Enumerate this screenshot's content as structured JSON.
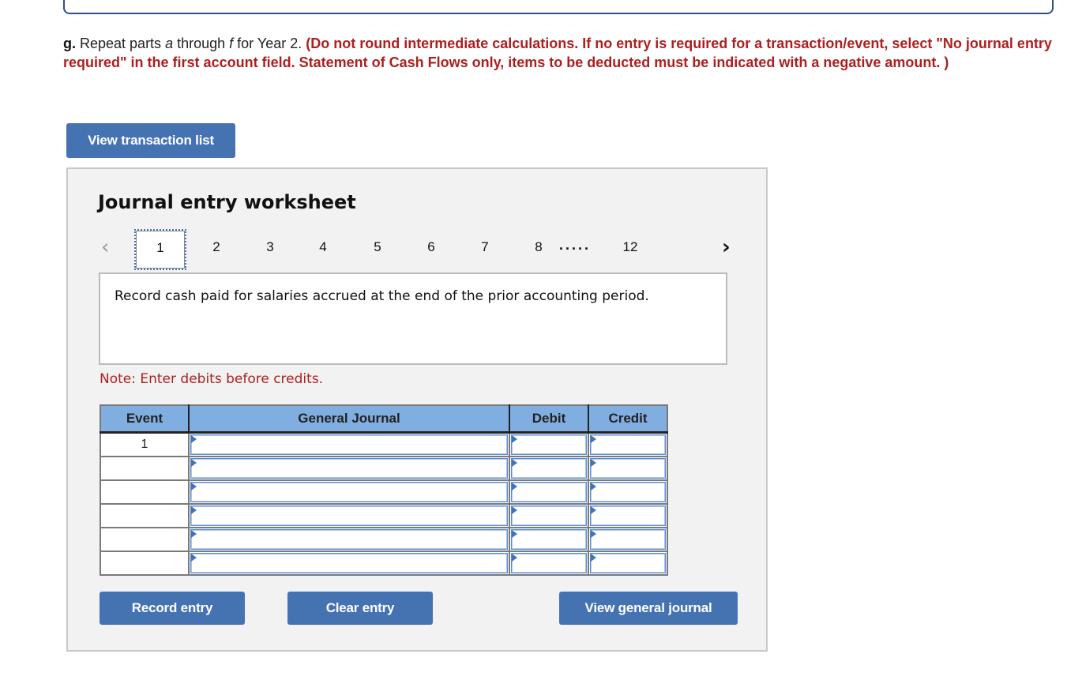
{
  "instructions": {
    "part_label": "g.",
    "text_before_a": " Repeat parts ",
    "var_a": "a",
    "text_through": " through ",
    "var_f": "f",
    "text_after": " for Year 2. ",
    "red_text": "(Do not round intermediate calculations. If no entry is required for a transaction/event, select \"No journal entry required\" in the first account field. Statement of Cash Flows only, items to be deducted must be indicated with a negative amount. )"
  },
  "buttons": {
    "view_transaction_list": "View transaction list",
    "record_entry": "Record entry",
    "clear_entry": "Clear entry",
    "view_general_journal": "View general journal"
  },
  "worksheet": {
    "title": "Journal entry worksheet",
    "pager": {
      "prev_icon": "‹",
      "next_icon": "›",
      "pages": [
        "1",
        "2",
        "3",
        "4",
        "5",
        "6",
        "7",
        "8"
      ],
      "ellipsis": ".....",
      "last_page": "12",
      "active_page": "1"
    },
    "description": "Record cash paid for salaries accrued at the end of the prior accounting period.",
    "note": "Note: Enter debits before credits.",
    "table": {
      "headers": [
        "Event",
        "General Journal",
        "Debit",
        "Credit"
      ],
      "rows": [
        {
          "event": "1",
          "account": "",
          "debit": "",
          "credit": ""
        },
        {
          "event": "",
          "account": "",
          "debit": "",
          "credit": ""
        },
        {
          "event": "",
          "account": "",
          "debit": "",
          "credit": ""
        },
        {
          "event": "",
          "account": "",
          "debit": "",
          "credit": ""
        },
        {
          "event": "",
          "account": "",
          "debit": "",
          "credit": ""
        },
        {
          "event": "",
          "account": "",
          "debit": "",
          "credit": ""
        }
      ]
    }
  },
  "colors": {
    "button_blue": "#4573b2",
    "header_blue": "#80aee0",
    "instruction_red": "#ad1f1f",
    "panel_gray": "#f2f2f2"
  }
}
